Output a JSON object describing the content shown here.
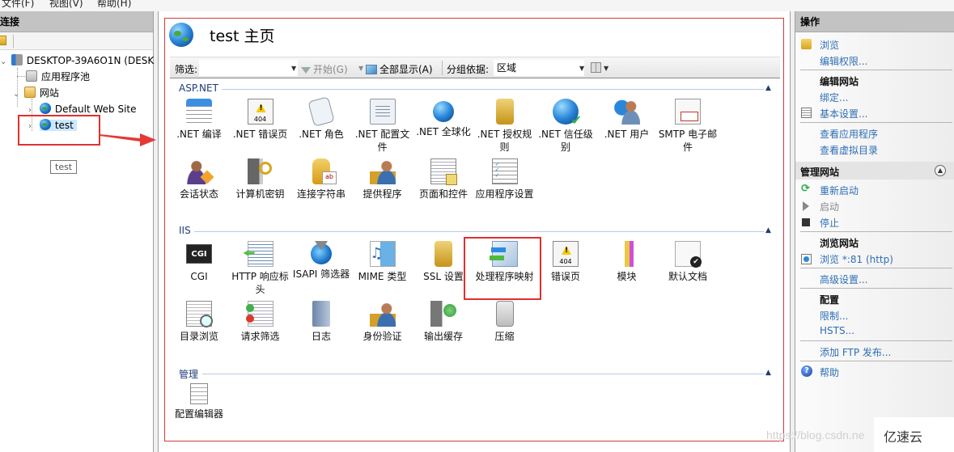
{
  "menubar": {
    "items": [
      "文件(F)",
      "视图(V)",
      "帮助(H)"
    ]
  },
  "connections": {
    "title": "连接",
    "tree": [
      {
        "label": "DESKTOP-39A6O1N (DESK",
        "icon": "server-icon",
        "expanded": true
      },
      {
        "label": "应用程序池",
        "icon": "app-pool-icon"
      },
      {
        "label": "网站",
        "icon": "sites-folder-icon",
        "expanded": true
      },
      {
        "label": "Default Web Site",
        "icon": "website-stopped-icon",
        "expanded": false
      },
      {
        "label": "test",
        "icon": "website-icon",
        "expanded": false,
        "selected": true
      }
    ],
    "tooltip": "test"
  },
  "center": {
    "title": "test 主页",
    "filter": {
      "label": "筛选:",
      "value": "",
      "go_label": "开始(G)",
      "show_all_label": "全部显示(A)",
      "group_by_label": "分组依据:",
      "group_by_value": "区域"
    },
    "sections": [
      {
        "title": "ASP.NET",
        "features": [
          {
            "label": ".NET 编译",
            "icon": "net-compilation-icon"
          },
          {
            "label": ".NET 错误页",
            "icon": "net-error-pages-icon"
          },
          {
            "label": ".NET 角色",
            "icon": "net-roles-icon"
          },
          {
            "label": ".NET 配置文件",
            "icon": "net-profile-icon"
          },
          {
            "label": ".NET 全球化",
            "icon": "net-globalization-icon"
          },
          {
            "label": ".NET 授权规则",
            "icon": "net-authorization-icon"
          },
          {
            "label": ".NET 信任级别",
            "icon": "net-trust-levels-icon"
          },
          {
            "label": ".NET 用户",
            "icon": "net-users-icon"
          },
          {
            "label": "SMTP 电子邮件",
            "icon": "smtp-email-icon"
          },
          {
            "label": "会话状态",
            "icon": "session-state-icon"
          },
          {
            "label": "计算机密钥",
            "icon": "machine-key-icon"
          },
          {
            "label": "连接字符串",
            "icon": "connection-strings-icon"
          },
          {
            "label": "提供程序",
            "icon": "providers-icon"
          },
          {
            "label": "页面和控件",
            "icon": "pages-controls-icon"
          },
          {
            "label": "应用程序设置",
            "icon": "app-settings-icon"
          }
        ]
      },
      {
        "title": "IIS",
        "features": [
          {
            "label": "CGI",
            "icon": "cgi-icon"
          },
          {
            "label": "HTTP 响应标头",
            "icon": "http-headers-icon"
          },
          {
            "label": "ISAPI 筛选器",
            "icon": "isapi-filters-icon"
          },
          {
            "label": "MIME 类型",
            "icon": "mime-types-icon"
          },
          {
            "label": "SSL 设置",
            "icon": "ssl-settings-icon"
          },
          {
            "label": "处理程序映射",
            "icon": "handler-mappings-icon"
          },
          {
            "label": "错误页",
            "icon": "error-pages-icon"
          },
          {
            "label": "模块",
            "icon": "modules-icon"
          },
          {
            "label": "默认文档",
            "icon": "default-document-icon"
          },
          {
            "label": "目录浏览",
            "icon": "directory-browsing-icon"
          },
          {
            "label": "请求筛选",
            "icon": "request-filtering-icon"
          },
          {
            "label": "日志",
            "icon": "logging-icon"
          },
          {
            "label": "身份验证",
            "icon": "authentication-icon"
          },
          {
            "label": "输出缓存",
            "icon": "output-caching-icon"
          },
          {
            "label": "压缩",
            "icon": "compression-icon"
          }
        ]
      },
      {
        "title": "管理",
        "features": [
          {
            "label": "配置编辑器",
            "icon": "configuration-editor-icon"
          }
        ]
      }
    ]
  },
  "actions": {
    "title": "操作",
    "items": {
      "browse": "浏览",
      "edit_permissions": "编辑权限...",
      "edit_site_head": "编辑网站",
      "bindings": "绑定...",
      "basic_settings": "基本设置...",
      "view_applications": "查看应用程序",
      "view_virtual_dirs": "查看虚拟目录",
      "manage_site_head": "管理网站",
      "restart": "重新启动",
      "start": "启动",
      "stop": "停止",
      "browse_site_head": "浏览网站",
      "browse_http": "浏览 *:81 (http)",
      "advanced_settings": "高级设置...",
      "config_head": "配置",
      "limits": "限制...",
      "hsts": "HSTS...",
      "add_ftp": "添加 FTP 发布...",
      "help": "帮助"
    }
  },
  "overlay": {
    "watermark": "https://blog.csdn.ne",
    "brand": "亿速云"
  }
}
